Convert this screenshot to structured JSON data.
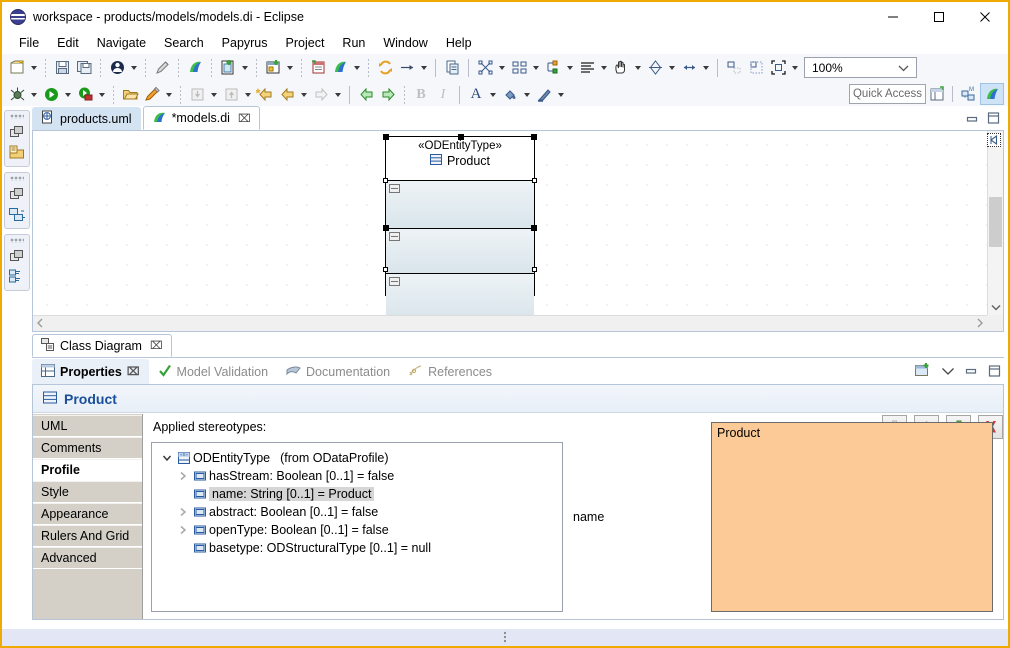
{
  "window": {
    "title": "workspace - products/models/models.di - Eclipse",
    "logo_icon": "eclipse-logo-icon",
    "minimize_label": "—",
    "maximize_label": "□",
    "close_label": "✕"
  },
  "menubar": {
    "items": [
      "File",
      "Edit",
      "Navigate",
      "Search",
      "Papyrus",
      "Project",
      "Run",
      "Window",
      "Help"
    ]
  },
  "toolbar": {
    "zoom_value": "100%",
    "quick_access_placeholder": "Quick Access",
    "row1_icons": [
      "new-wizard-icon",
      "save-icon",
      "save-all-icon",
      "person-icon",
      "pencil-icon",
      "papyrus-icon",
      "new-papyrus-model-icon",
      "new-diagram-icon",
      "new-table-icon",
      "papyrus-perspective-icon",
      "sync-icon",
      "arrow-right-icon",
      "copy-to-icon",
      "layout-nodes-icon",
      "distribute-icon",
      "align-nodes-icon",
      "align-text-icon",
      "hand-icon",
      "resize-icon",
      "horizontal-resize-icon",
      "snap-bottom-icon",
      "snap-grid-icon",
      "fit-to-view-icon"
    ],
    "row2_icons": [
      "debug-icon",
      "run-icon",
      "run-external-icon",
      "open-folder-icon",
      "marker-icon",
      "step-into-icon",
      "step-return-icon",
      "back-star-icon",
      "back-arrow-icon",
      "forward-arrow-icon",
      "prev-annotation-icon",
      "next-annotation-icon",
      "bold-icon",
      "italic-icon",
      "font-color-icon",
      "fill-color-icon",
      "line-color-icon"
    ],
    "perspective_icons": [
      "open-perspective-icon",
      "modeling-perspective-icon",
      "papyrus-perspective-active-icon"
    ]
  },
  "fastview": {
    "groups": [
      {
        "handle": "drag-handle",
        "restore_icon": "restore-view-icon",
        "view_icon": "project-explorer-icon"
      },
      {
        "handle": "drag-handle",
        "restore_icon": "restore-view-icon",
        "view_icon": "model-explorer-icon"
      },
      {
        "handle": "drag-handle",
        "restore_icon": "restore-view-icon",
        "view_icon": "outline-view-icon"
      }
    ]
  },
  "editor": {
    "tabs": [
      {
        "label": "products.uml",
        "icon": "uml-file-icon",
        "active": false,
        "closable": false
      },
      {
        "label": "*models.di",
        "icon": "papyrus-file-icon",
        "active": true,
        "closable": true
      }
    ],
    "minimize_icon": "minimize-icon",
    "maximize_icon": "maximize-icon",
    "diagram": {
      "stereotype": "«ODEntityType»",
      "class_name": "Product",
      "class_icon": "uml-class-icon",
      "compartments": [
        "attributes-compartment",
        "operations-compartment",
        "nested-compartment"
      ]
    },
    "outline_toggle_icon": "outline-toggle-icon",
    "scroll_left_icon": "scroll-left-icon",
    "scroll_right_icon": "scroll-right-icon",
    "scroll_up_icon": "scroll-up-icon",
    "scroll_down_icon": "scroll-down-icon"
  },
  "diagram_tab": {
    "label": "Class Diagram",
    "icon": "class-diagram-icon",
    "close_label": "⌧"
  },
  "properties": {
    "tabs": [
      {
        "label": "Properties",
        "icon": "properties-icon",
        "active": true,
        "close_label": "⌧"
      },
      {
        "label": "Model Validation",
        "icon": "validation-check-icon",
        "active": false
      },
      {
        "label": "Documentation",
        "icon": "documentation-icon",
        "active": false
      },
      {
        "label": "References",
        "icon": "references-icon",
        "active": false
      }
    ],
    "toolbar_icons": [
      "new-properties-view-icon",
      "view-menu-icon",
      "minimize-icon",
      "maximize-icon"
    ],
    "title": "Product",
    "title_icon": "uml-class-icon",
    "side_tabs": [
      {
        "label": "UML",
        "selected": false
      },
      {
        "label": "Comments",
        "selected": false
      },
      {
        "label": "Profile",
        "selected": true
      },
      {
        "label": "Style",
        "selected": false
      },
      {
        "label": "Appearance",
        "selected": false
      },
      {
        "label": "Rulers And Grid",
        "selected": false
      },
      {
        "label": "Advanced",
        "selected": false
      }
    ],
    "profile_page": {
      "applied_label": "Applied stereotypes:",
      "buttons": [
        {
          "name": "move-down-button",
          "icon": "arrow-down-icon",
          "enabled": false
        },
        {
          "name": "move-up-button",
          "icon": "arrow-up-icon",
          "enabled": false
        },
        {
          "name": "add-stereotype-button",
          "icon": "plus-icon",
          "enabled": true
        },
        {
          "name": "remove-stereotype-button",
          "icon": "delete-x-icon",
          "enabled": true
        }
      ],
      "tree": [
        {
          "label": "ODEntityType",
          "from": "(from ODataProfile)",
          "icon": "stereotype-icon",
          "twisty": "expanded",
          "level": 0,
          "selected": false
        },
        {
          "label": "hasStream: Boolean [0..1] = false",
          "icon": "property-icon",
          "twisty": "collapsed",
          "level": 1,
          "selected": false
        },
        {
          "label": "name: String [0..1] = Product",
          "icon": "property-icon",
          "twisty": "none",
          "level": 1,
          "selected": true
        },
        {
          "label": "abstract: Boolean [0..1] = false",
          "icon": "property-icon",
          "twisty": "collapsed",
          "level": 1,
          "selected": false
        },
        {
          "label": "openType: Boolean [0..1] = false",
          "icon": "property-icon",
          "twisty": "collapsed",
          "level": 1,
          "selected": false
        },
        {
          "label": "basetype: ODStructuralType [0..1] = null",
          "icon": "property-icon",
          "twisty": "none",
          "level": 1,
          "selected": false
        }
      ],
      "detail": {
        "field_label": "name",
        "field_value": "Product",
        "field_bg_color": "#fcca96"
      }
    }
  },
  "colors": {
    "window_border": "#f0ab00",
    "toolbar_bg": "#f6f7fb",
    "tab_active": "#ffffff",
    "tab_inactive": "#d4e3f2",
    "title_accent": "#1a4f9c",
    "status_bg": "#e3e7f5",
    "value_field": "#fcca96"
  }
}
